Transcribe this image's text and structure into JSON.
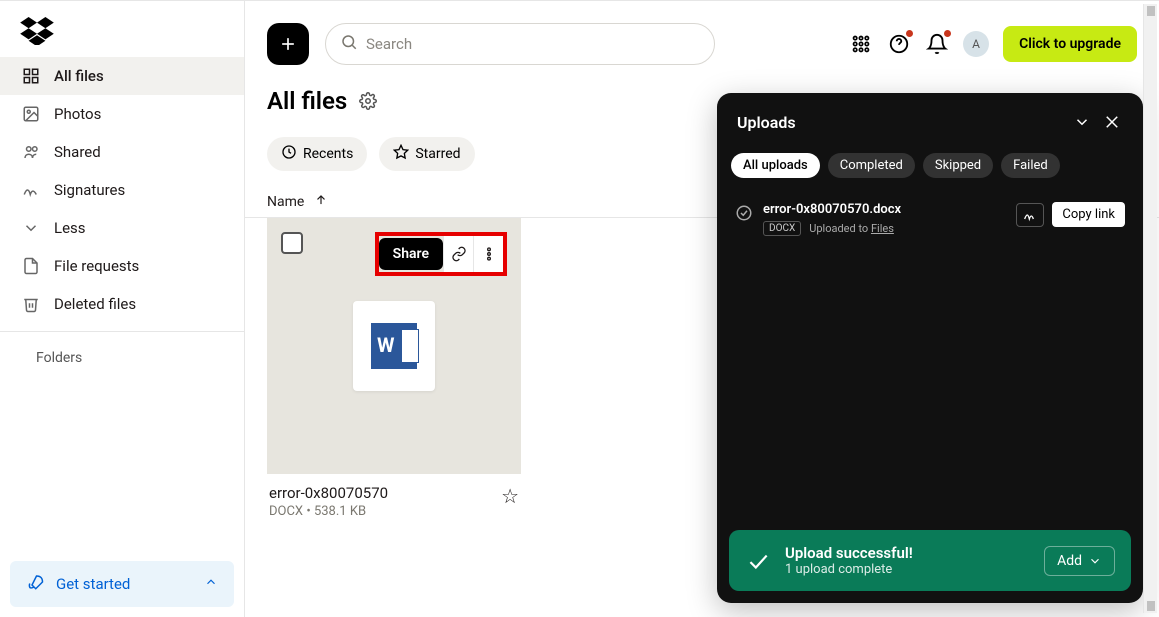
{
  "sidebar": {
    "items": [
      {
        "label": "All files"
      },
      {
        "label": "Photos"
      },
      {
        "label": "Shared"
      },
      {
        "label": "Signatures"
      },
      {
        "label": "Less"
      },
      {
        "label": "File requests"
      },
      {
        "label": "Deleted files"
      }
    ],
    "folders_label": "Folders",
    "get_started": "Get started"
  },
  "topbar": {
    "search_placeholder": "Search",
    "avatar_initial": "A",
    "upgrade_label": "Click to upgrade"
  },
  "page": {
    "title": "All files",
    "chips": {
      "recents": "Recents",
      "starred": "Starred"
    },
    "column_header": "Name"
  },
  "file": {
    "share_label": "Share",
    "name": "error-0x80070570",
    "ext": "DOCX",
    "size": "538.1 KB"
  },
  "uploads": {
    "title": "Uploads",
    "tabs": {
      "all": "All uploads",
      "completed": "Completed",
      "skipped": "Skipped",
      "failed": "Failed"
    },
    "item": {
      "filename": "error-0x80070570.docx",
      "ext_badge": "DOCX",
      "dest_prefix": "Uploaded to ",
      "dest_link": "Files",
      "copy_label": "Copy link"
    },
    "footer": {
      "title": "Upload successful!",
      "subtitle": "1 upload complete",
      "add_label": "Add"
    }
  }
}
